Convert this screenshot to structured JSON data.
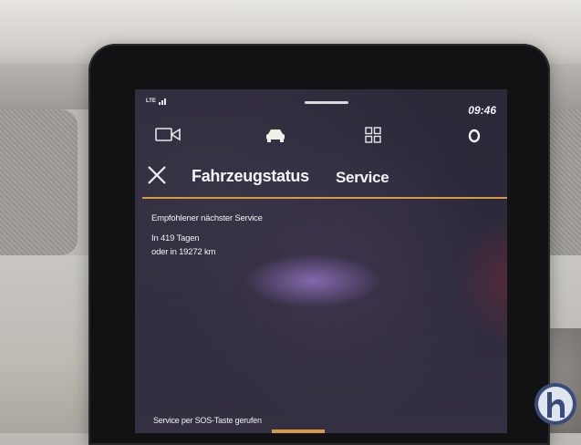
{
  "status_bar": {
    "network": "LTE",
    "time": "09:46"
  },
  "nav_icons": [
    "camera-icon",
    "car-icon",
    "apps-grid-icon",
    "circle-icon"
  ],
  "header": {
    "title": "Fahrzeugstatus",
    "active_tab": "Service"
  },
  "service": {
    "heading": "Empfohlener nächster Service",
    "days": "In 419 Tagen",
    "distance": "oder in 19272 km",
    "sos_note": "Service per SOS-Taste gerufen"
  },
  "colors": {
    "accent": "#d49a45",
    "screen_bg": "#2d2a3b",
    "text": "#f2f2f5"
  }
}
